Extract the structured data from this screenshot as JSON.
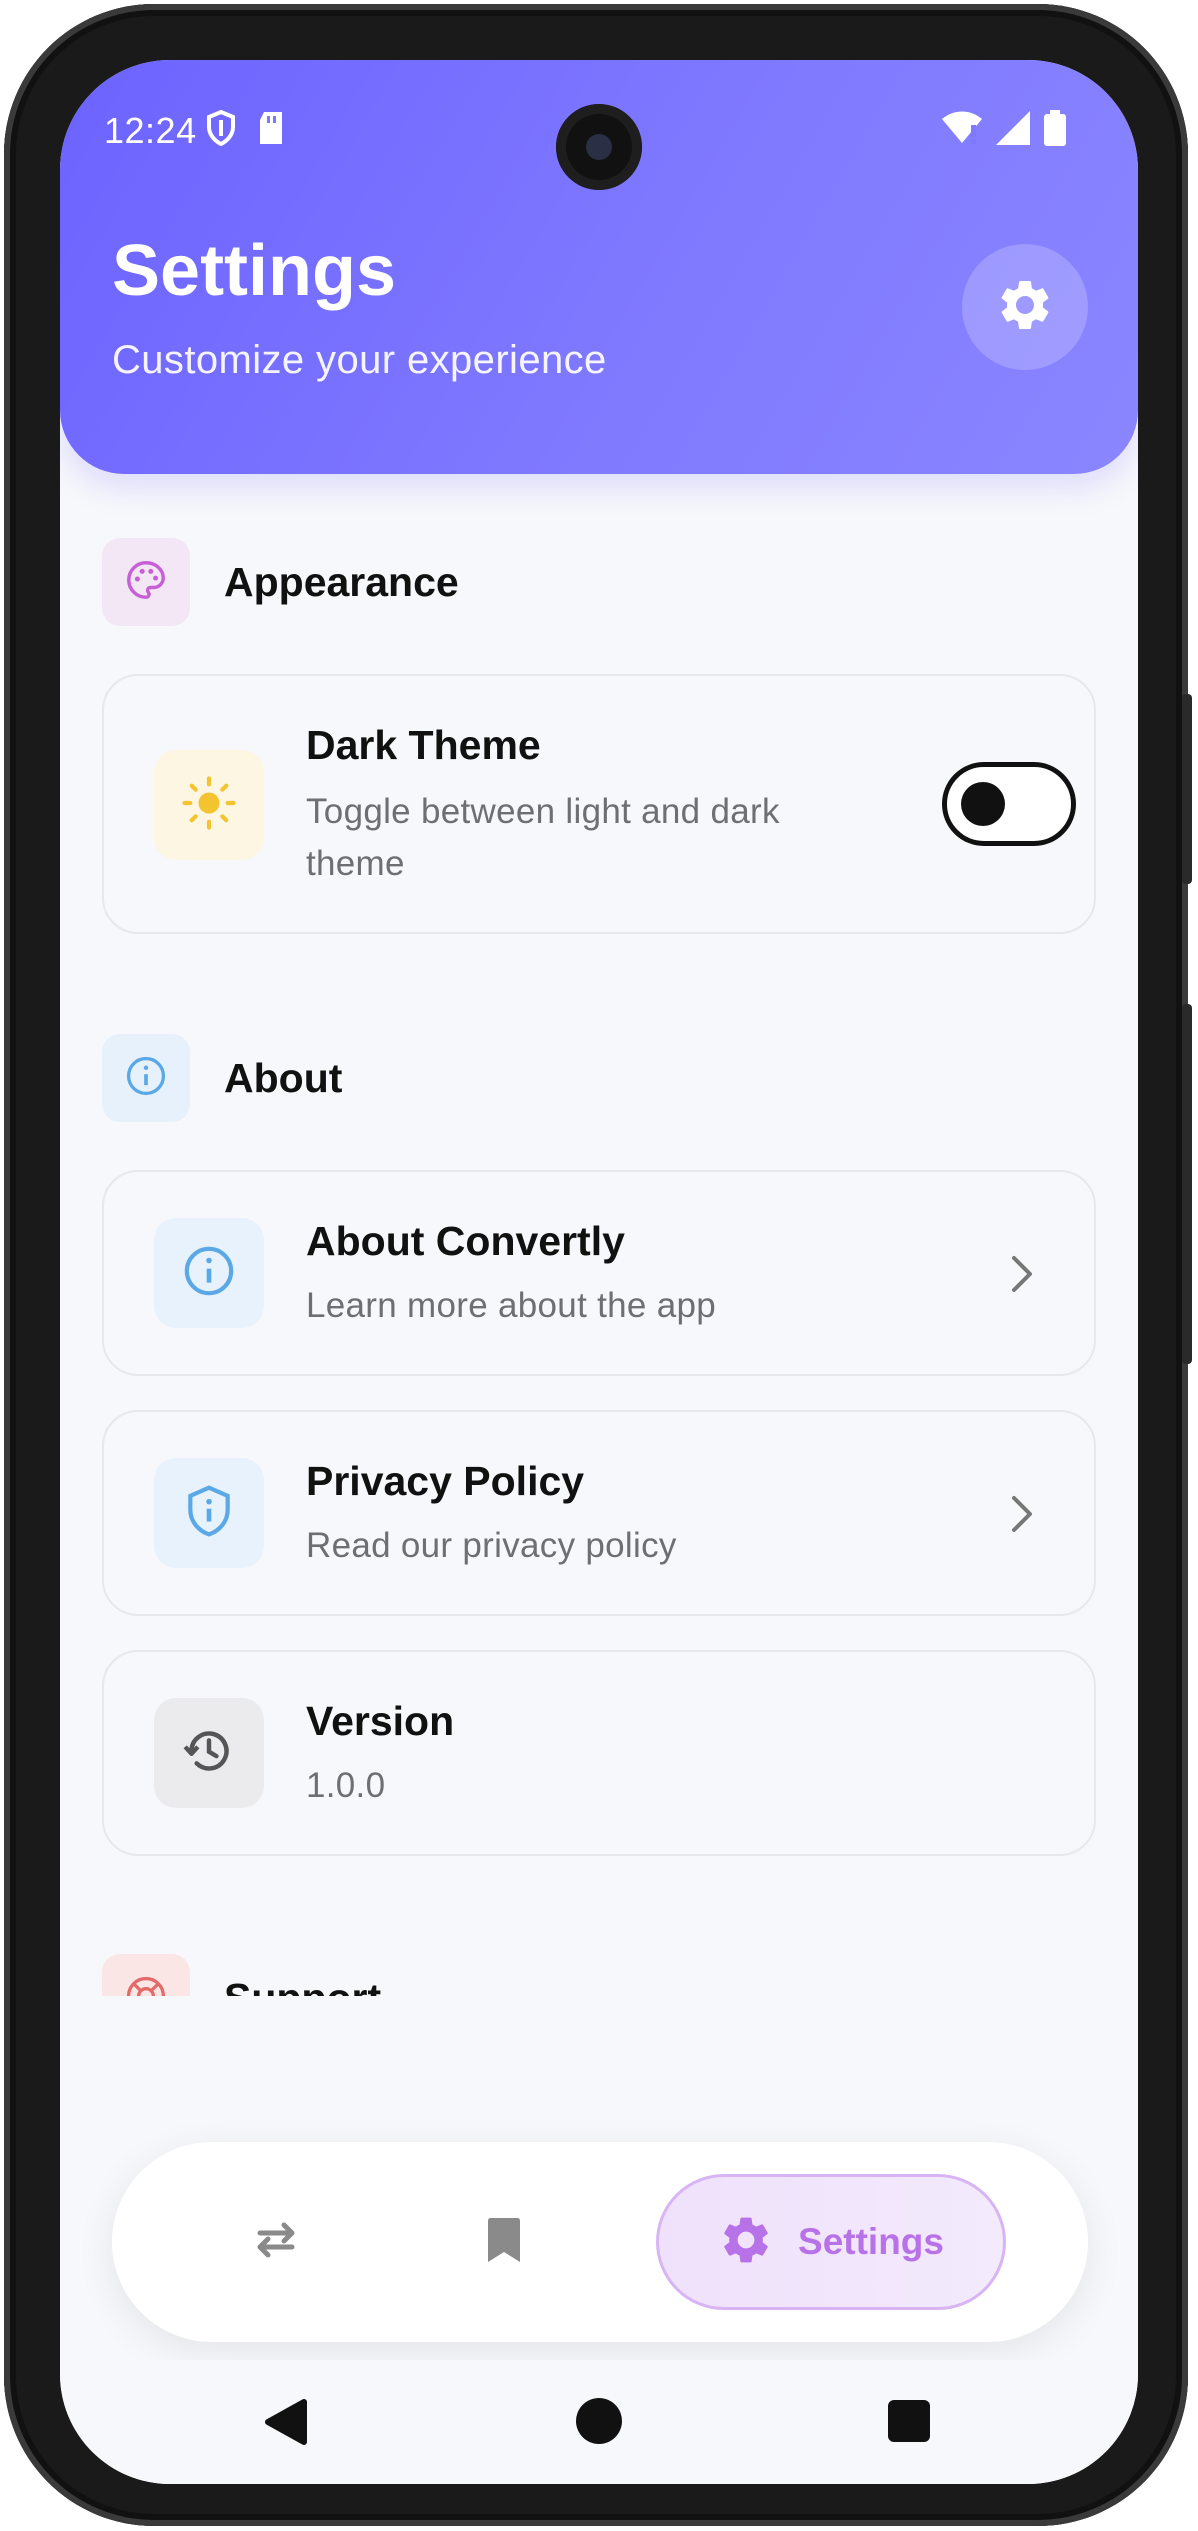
{
  "status_bar": {
    "time": "12:24"
  },
  "header": {
    "title": "Settings",
    "subtitle": "Customize your experience"
  },
  "sections": {
    "appearance": {
      "title": "Appearance",
      "dark_theme": {
        "title": "Dark Theme",
        "subtitle": "Toggle between light and dark theme",
        "enabled": false
      }
    },
    "about": {
      "title": "About",
      "about_app": {
        "title": "About Convertly",
        "subtitle": "Learn more about the app"
      },
      "privacy": {
        "title": "Privacy Policy",
        "subtitle": "Read our privacy policy"
      },
      "version": {
        "title": "Version",
        "value": "1.0.0"
      }
    },
    "support": {
      "title": "Support"
    }
  },
  "bottom_nav": {
    "items": [
      {
        "icon": "swap-arrows-icon",
        "label": ""
      },
      {
        "icon": "bookmark-icon",
        "label": ""
      },
      {
        "icon": "gear-icon",
        "label": "Settings",
        "active": true
      }
    ]
  },
  "colors": {
    "accent": "#6c63ff",
    "active_nav": "#b872e8",
    "appearance_icon": "#c75fd6",
    "info_icon": "#5aa9e6",
    "sun_icon": "#f4c430"
  }
}
